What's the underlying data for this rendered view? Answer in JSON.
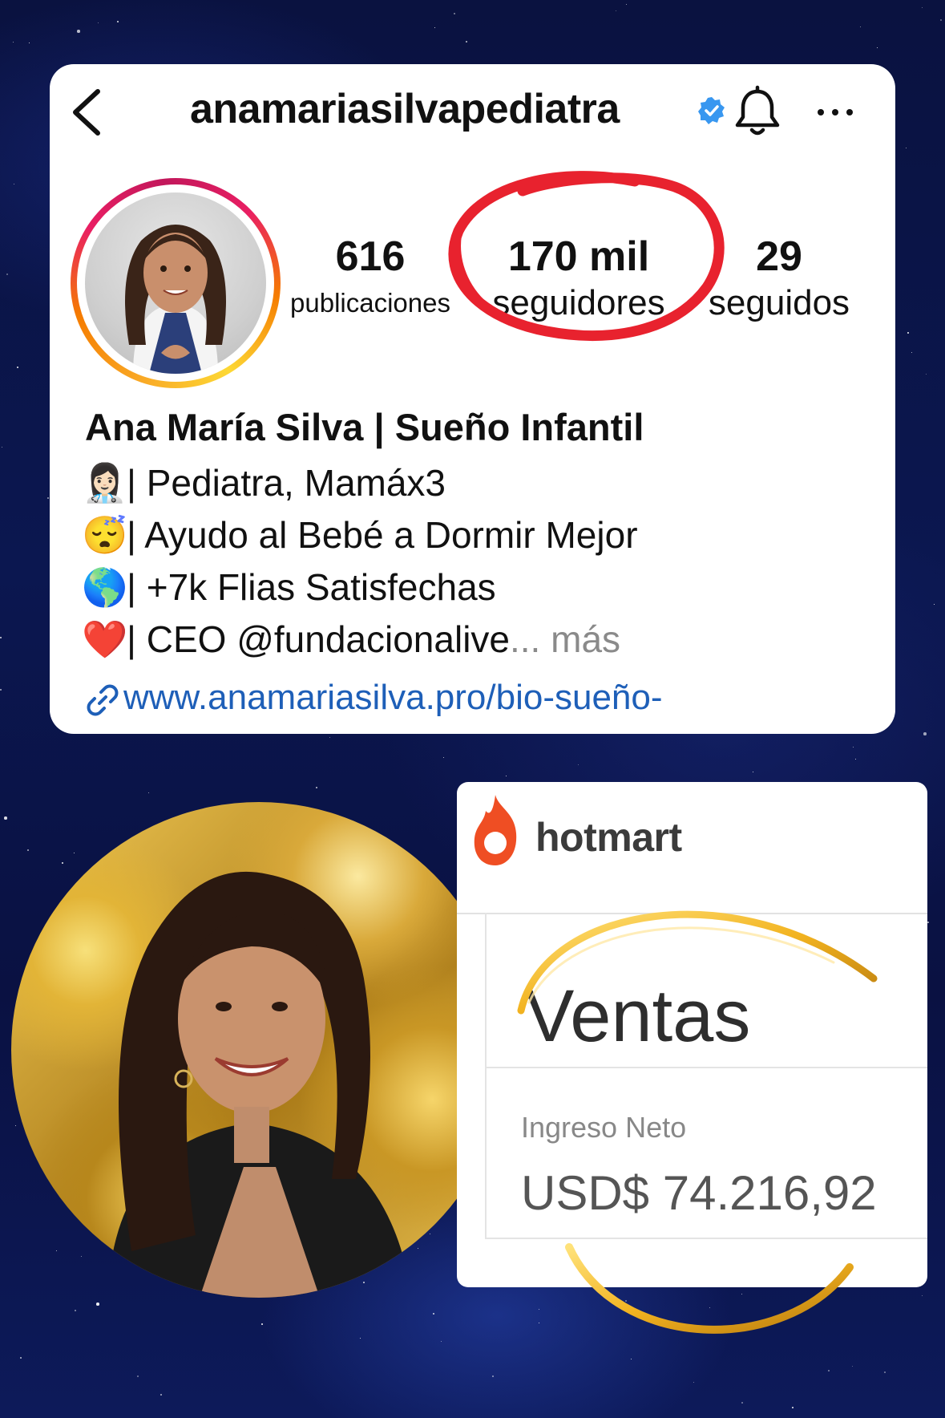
{
  "instagram": {
    "username": "anamariasilvapediatra",
    "stats": {
      "posts_count": "616",
      "posts_label": "publicaciones",
      "followers_count": "170 mil",
      "followers_label": "seguidores",
      "following_count": "29",
      "following_label": "seguidos"
    },
    "bio": {
      "name": "Ana María Silva | Sueño Infantil",
      "lines": [
        {
          "emoji": "👩🏻‍⚕️",
          "text": "| Pediatra, Mamáx3"
        },
        {
          "emoji": "😴",
          "text": "| Ayudo al Bebé a Dormir Mejor"
        },
        {
          "emoji": "🌎",
          "text": "| +7k Flias Satisfechas"
        },
        {
          "emoji": "❤️",
          "text": "| CEO @fundacionalive",
          "more": "... más"
        }
      ],
      "link": "www.anamariasilva.pro/bio-sueño-"
    },
    "icons": [
      "back-icon",
      "verified-icon",
      "bell-icon",
      "more-icon",
      "link-icon"
    ],
    "colors": {
      "verified": "#3897f0",
      "link": "#1e5fb8",
      "highlight": "#e8222e"
    }
  },
  "hotmart": {
    "brand": "hotmart",
    "section_title": "Ventas",
    "metric_label": "Ingreso Neto",
    "metric_value": "USD$ 74.216,92",
    "colors": {
      "brand": "#ef4e23",
      "gold": "#f2b320"
    }
  }
}
